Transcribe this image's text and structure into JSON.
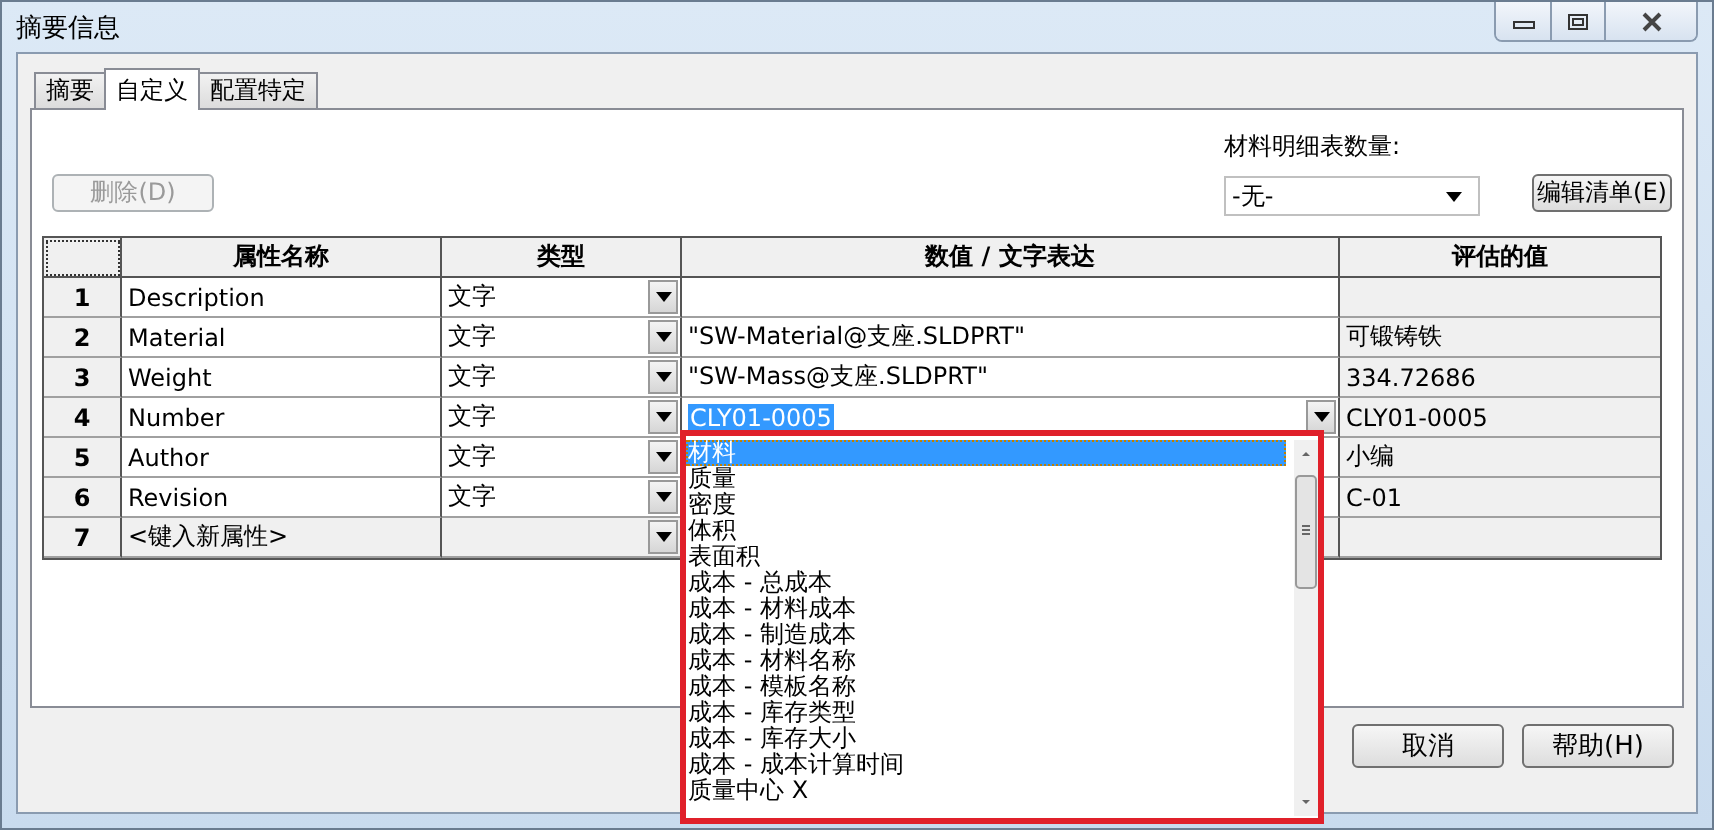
{
  "window": {
    "title": "摘要信息"
  },
  "tabs": [
    {
      "label": "摘要",
      "selected": false
    },
    {
      "label": "自定义",
      "selected": true
    },
    {
      "label": "配置特定",
      "selected": false
    }
  ],
  "delete_button": {
    "label": "删除(D)",
    "disabled": true
  },
  "bom_quantity": {
    "label": "材料明细表数量:",
    "value": "-无-"
  },
  "edit_list_button": {
    "label": "编辑清单(E)"
  },
  "table": {
    "columns": [
      "属性名称",
      "类型",
      "数值 / 文字表达",
      "评估的值"
    ],
    "rows": [
      {
        "number": "1",
        "name": "Description",
        "type": "文字",
        "value": "",
        "evaluated": "",
        "kind": "property",
        "editing": false
      },
      {
        "number": "2",
        "name": "Material",
        "type": "文字",
        "value": "\"SW-Material@支座.SLDPRT\"",
        "evaluated": "可锻铸铁",
        "kind": "property",
        "editing": false
      },
      {
        "number": "3",
        "name": "Weight",
        "type": "文字",
        "value": "\"SW-Mass@支座.SLDPRT\"",
        "evaluated": "334.72686",
        "kind": "property",
        "editing": false
      },
      {
        "number": "4",
        "name": "Number",
        "type": "文字",
        "value": "CLY01-0005",
        "evaluated": "CLY01-0005",
        "kind": "property",
        "editing": true
      },
      {
        "number": "5",
        "name": "Author",
        "type": "文字",
        "value": "",
        "evaluated": "小编",
        "kind": "property",
        "editing": false
      },
      {
        "number": "6",
        "name": "Revision",
        "type": "文字",
        "value": "",
        "evaluated": "C-01",
        "kind": "property",
        "editing": false
      },
      {
        "number": "7",
        "name": "<键入新属性>",
        "type": "",
        "value": "",
        "evaluated": "",
        "kind": "new",
        "editing": false
      }
    ]
  },
  "dropdown": {
    "items": [
      {
        "label": "材料",
        "selected": true
      },
      {
        "label": "质量",
        "selected": false
      },
      {
        "label": "密度",
        "selected": false
      },
      {
        "label": "体积",
        "selected": false
      },
      {
        "label": "表面积",
        "selected": false
      },
      {
        "label": "成本 - 总成本",
        "selected": false
      },
      {
        "label": "成本 - 材料成本",
        "selected": false
      },
      {
        "label": "成本 - 制造成本",
        "selected": false
      },
      {
        "label": "成本 - 材料名称",
        "selected": false
      },
      {
        "label": "成本 - 模板名称",
        "selected": false
      },
      {
        "label": "成本 - 库存类型",
        "selected": false
      },
      {
        "label": "成本 - 库存大小",
        "selected": false
      },
      {
        "label": "成本 - 成本计算时间",
        "selected": false
      },
      {
        "label": "质量中心 X",
        "selected": false
      }
    ]
  },
  "buttons": [
    {
      "label": "取消"
    },
    {
      "label": "帮助(H)"
    }
  ]
}
